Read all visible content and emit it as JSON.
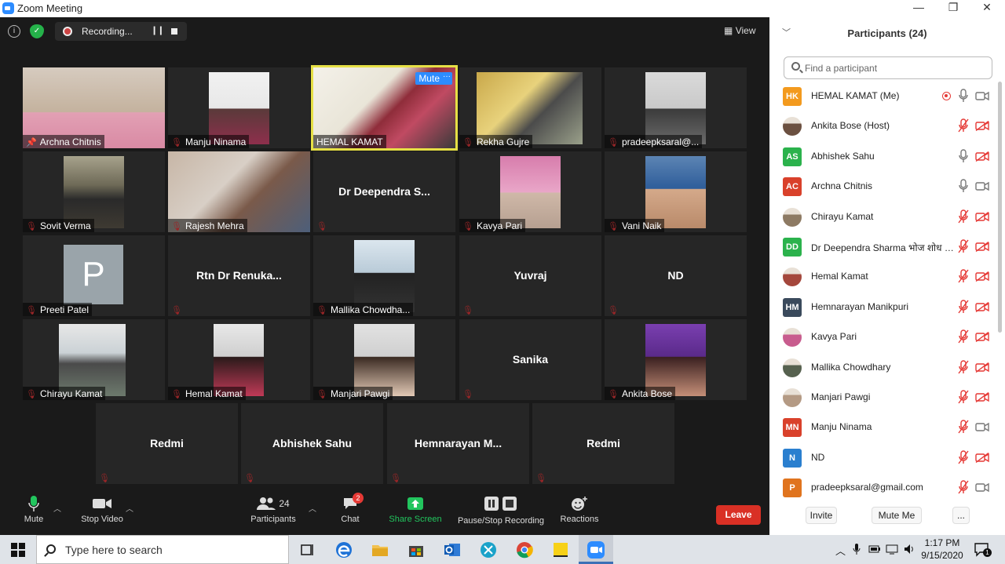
{
  "window": {
    "title": "Zoom Meeting",
    "minimize_glyph": "—",
    "restore_glyph": "❐",
    "close_glyph": "✕"
  },
  "topbar": {
    "recording_text": "Recording...",
    "view_label": "View"
  },
  "tiles": [
    {
      "name": "Archna Chitnis",
      "pinned": true
    },
    {
      "name": "Manju Ninama"
    },
    {
      "name": "HEMAL KAMAT",
      "active": true,
      "mute_label": "Mute",
      "more_label": "···"
    },
    {
      "name": "Rekha Gujre"
    },
    {
      "name": "pradeepksaral@..."
    },
    {
      "name": "Sovit Verma"
    },
    {
      "name": "Rajesh Mehra"
    },
    {
      "name": "",
      "center": "Dr  Deependra  S..."
    },
    {
      "name": "Kavya Pari"
    },
    {
      "name": "Vani Naik"
    },
    {
      "name": "Preeti Patel",
      "avatar_letter": "P"
    },
    {
      "name": "",
      "center": "Rtn Dr Renuka..."
    },
    {
      "name": "Mallika Chowdha..."
    },
    {
      "name": "",
      "center": "Yuvraj"
    },
    {
      "name": "",
      "center": "ND"
    },
    {
      "name": "Chirayu Kamat"
    },
    {
      "name": "Hemal Kamat"
    },
    {
      "name": "Manjari Pawgi"
    },
    {
      "name": "",
      "center": "Sanika"
    },
    {
      "name": "Ankita Bose"
    },
    {
      "name": "",
      "center": "Redmi"
    },
    {
      "name": "",
      "center": "Abhishek Sahu"
    },
    {
      "name": "",
      "center": "Hemnarayan  M..."
    },
    {
      "name": "",
      "center": "Redmi"
    }
  ],
  "toolbar": {
    "mute": "Mute",
    "stop_video": "Stop Video",
    "participants": "Participants",
    "participants_count": "24",
    "chat": "Chat",
    "chat_badge": "2",
    "share_screen": "Share Screen",
    "pause_stop": "Pause/Stop Recording",
    "reactions": "Reactions",
    "leave": "Leave"
  },
  "panel": {
    "title": "Participants (24)",
    "search_placeholder": "Find a participant",
    "participants": [
      {
        "initials": "HK",
        "color": "#f39a1e",
        "name": "HEMAL KAMAT (Me)",
        "mic": "on",
        "cam": "on",
        "recording": true
      },
      {
        "initials": "",
        "color": "#6b5040",
        "name": "Ankita Bose (Host)",
        "mic": "off",
        "cam": "off"
      },
      {
        "initials": "AS",
        "color": "#2bb24c",
        "name": "Abhishek Sahu",
        "mic": "on",
        "cam": "off"
      },
      {
        "initials": "AC",
        "color": "#d9412b",
        "name": "Archna Chitnis",
        "mic": "on",
        "cam": "on"
      },
      {
        "initials": "",
        "color": "#8d7a63",
        "name": "Chirayu Kamat",
        "mic": "off",
        "cam": "off"
      },
      {
        "initials": "DD",
        "color": "#2bb24c",
        "name": "Dr Deependra Sharma भोज शोध संस्थान",
        "mic": "off",
        "cam": "off"
      },
      {
        "initials": "",
        "color": "#a4473c",
        "name": "Hemal Kamat",
        "mic": "off",
        "cam": "off"
      },
      {
        "initials": "HM",
        "color": "#3a4a5c",
        "name": "Hemnarayan Manikpuri",
        "mic": "off",
        "cam": "off"
      },
      {
        "initials": "",
        "color": "#c85c8e",
        "name": "Kavya Pari",
        "mic": "off",
        "cam": "off"
      },
      {
        "initials": "",
        "color": "#56614f",
        "name": "Mallika Chowdhary",
        "mic": "off",
        "cam": "off"
      },
      {
        "initials": "",
        "color": "#b49a84",
        "name": "Manjari Pawgi",
        "mic": "off",
        "cam": "off"
      },
      {
        "initials": "MN",
        "color": "#d9412b",
        "name": "Manju Ninama",
        "mic": "off",
        "cam": "on"
      },
      {
        "initials": "N",
        "color": "#2a7fcf",
        "name": "ND",
        "mic": "off",
        "cam": "off"
      },
      {
        "initials": "P",
        "color": "#e0741e",
        "name": "pradeepksaral@gmail.com",
        "mic": "off",
        "cam": "on"
      }
    ],
    "invite": "Invite",
    "mute_me": "Mute Me",
    "more": "..."
  },
  "taskbar": {
    "search_placeholder": "Type here to search",
    "time": "1:17 PM",
    "date": "9/15/2020",
    "notif_count": "1"
  }
}
